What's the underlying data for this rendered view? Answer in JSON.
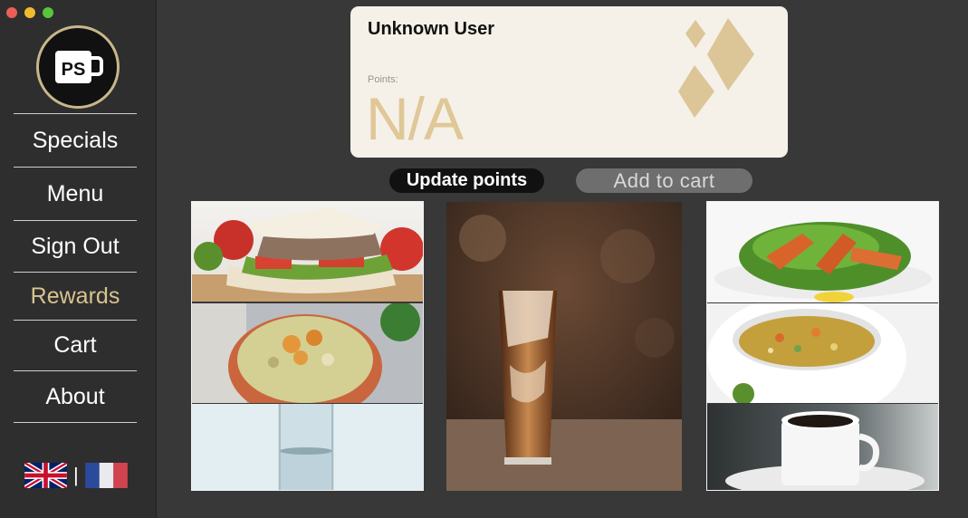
{
  "window": {
    "traffic_lights": [
      "close",
      "minimize",
      "zoom"
    ],
    "colors": {
      "close": "#ec5f56",
      "minimize": "#f2bb2f",
      "zoom": "#58c53c"
    }
  },
  "sidebar": {
    "logo_text": "PS",
    "items": [
      {
        "label": "Specials",
        "active": false
      },
      {
        "label": "Menu",
        "active": false
      },
      {
        "label": "Sign Out",
        "active": false
      },
      {
        "label": "Rewards",
        "active": true
      },
      {
        "label": "Cart",
        "active": false
      },
      {
        "label": "About",
        "active": false
      }
    ],
    "language_separator": "|",
    "languages": [
      "english-flag-icon",
      "french-flag-icon"
    ]
  },
  "card": {
    "user_name": "Unknown User",
    "points_label": "Points:",
    "points_value": "N/A",
    "accent_color": "#dfc797"
  },
  "actions": {
    "update_label": "Update points",
    "add_to_cart_label": "Add to cart"
  },
  "products": [
    {
      "image": "sandwich"
    },
    {
      "image": "chicken-curry-bowl"
    },
    {
      "image": "glass-of-water"
    },
    {
      "image": "iced-coffee"
    },
    {
      "image": "grilled-chicken-salad"
    },
    {
      "image": "vegetable-soup"
    },
    {
      "image": "coffee-mug"
    }
  ]
}
